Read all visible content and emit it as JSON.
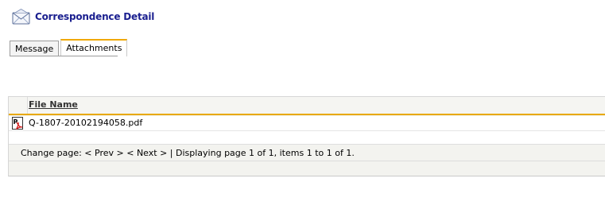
{
  "header": {
    "title": "Correspondence Detail",
    "icon": "envelope-icon"
  },
  "tabs": [
    {
      "label": "Message",
      "active": false
    },
    {
      "label": "Attachments",
      "active": true
    }
  ],
  "grid": {
    "columns": [
      "File Name"
    ],
    "rows": [
      {
        "icon": "pdf-icon",
        "file_name": "Q-1807-20102194058.pdf"
      }
    ]
  },
  "pager": {
    "change_label": "Change page:",
    "prev": "< Prev >",
    "next": "< Next >",
    "separator": "|",
    "status": "Displaying page 1 of 1, items 1 to 1 of 1."
  },
  "colors": {
    "title": "#1a1f8f",
    "tab_accent": "#f0a800",
    "header_rule": "#e8a800"
  }
}
